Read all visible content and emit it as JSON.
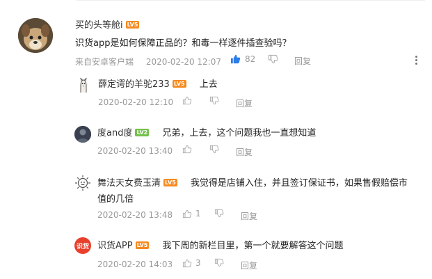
{
  "main": {
    "username": "买的头等舱i",
    "level": "LV5",
    "text": "识货app是如何保障正品的？和毒一样逐件插查验吗？",
    "source": "来自安卓客户端",
    "time": "2020-02-20 12:07",
    "likes": "82",
    "reply_label": "回复"
  },
  "replies": [
    {
      "username": "薛定谔的羊驼233",
      "level": "LV5",
      "text": "上去",
      "time": "2020-02-20 12:10",
      "likes": "",
      "reply_label": "回复"
    },
    {
      "username": "度and度",
      "level": "LV2",
      "text": "兄弟，上去，这个问题我也一直想知道",
      "time": "2020-02-20 13:40",
      "likes": "",
      "reply_label": "回复"
    },
    {
      "username": "舞法天女费玉清",
      "level": "LV5",
      "text_line1": "我觉得是店铺入住，并且签订保证书，如果售假赔偿市",
      "text_line2": "值的几倍",
      "time": "2020-02-20 13:48",
      "likes": "1",
      "reply_label": "回复"
    },
    {
      "username": "识货APP",
      "level": "LV5",
      "avatar_text": "识货",
      "text": "我下周的新栏目里，第一个就要解答这个问题",
      "time": "2020-02-20 14:03",
      "likes": "3",
      "reply_label": "回复"
    }
  ],
  "colors": {
    "like_active": "#2b7de9",
    "level_orange": "#f58a1f",
    "level_green": "#74c04b",
    "brand_red": "#e8402d"
  }
}
